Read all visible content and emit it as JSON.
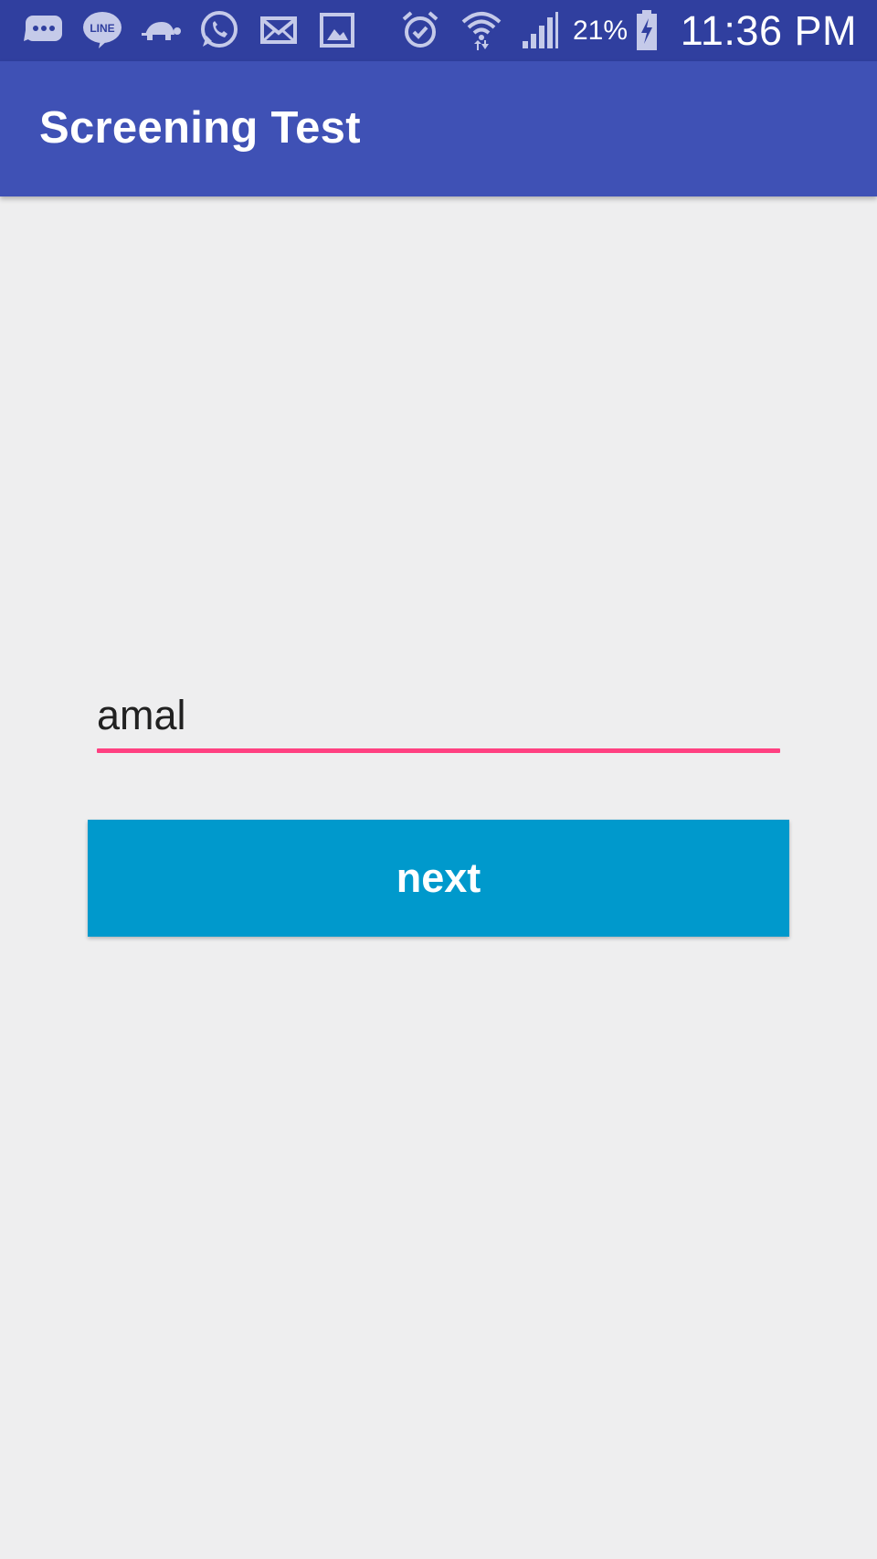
{
  "status_bar": {
    "notification_icons": [
      "messages-icon",
      "line-icon",
      "turtle-icon",
      "whatsapp-icon",
      "mail-icon",
      "gallery-icon"
    ],
    "system_icons": [
      "alarm-icon",
      "wifi-icon",
      "signal-icon",
      "battery-charging-icon"
    ],
    "battery_percent": "21%",
    "time": "11:36 PM",
    "color": "#303f9f"
  },
  "app_bar": {
    "title": "Screening Test",
    "color": "#3f51b5"
  },
  "form": {
    "name_value": "amal",
    "underline_color": "#ff4081",
    "next_label": "next",
    "button_color": "#0099cc"
  }
}
